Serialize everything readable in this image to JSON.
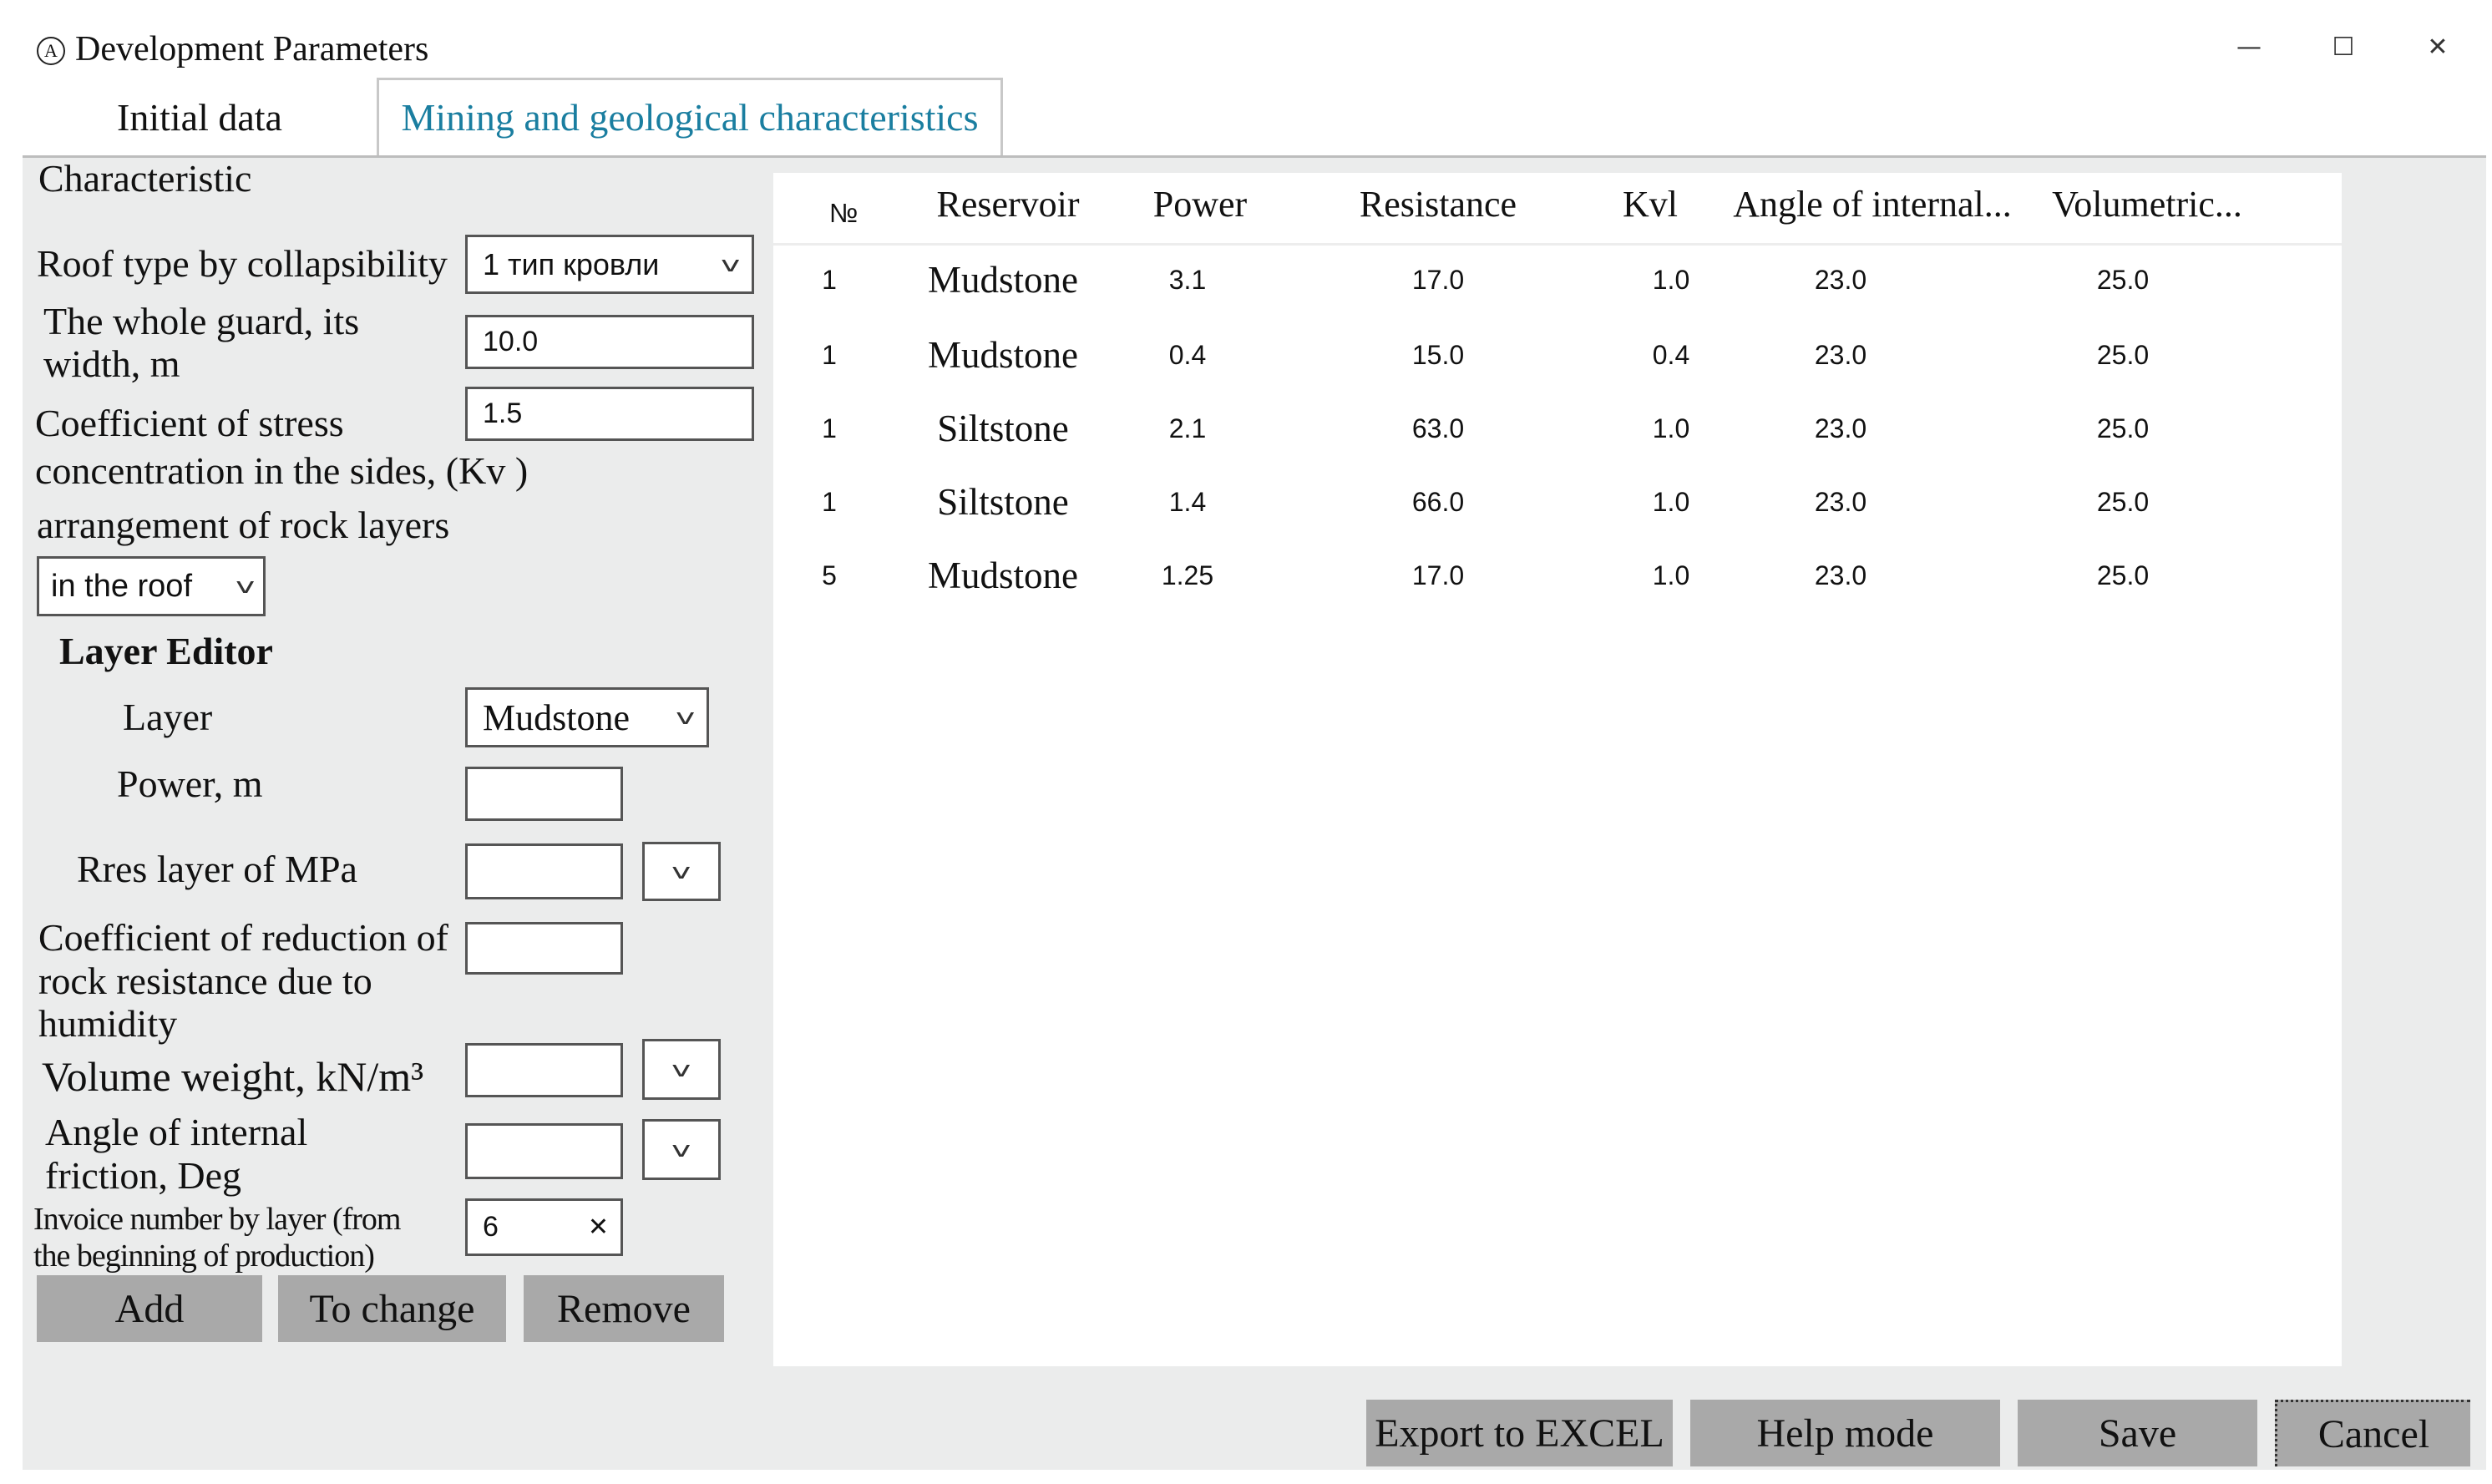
{
  "window": {
    "title": "Development Parameters",
    "logo_letter": "A",
    "minimize": "—",
    "maximize": "☐",
    "close": "✕"
  },
  "tabs": [
    {
      "label": "Initial data",
      "active": false
    },
    {
      "label": "Mining and geological characteristics",
      "active": true
    }
  ],
  "form": {
    "section_title": "Characteristic",
    "roof_type": {
      "label": "Roof type by collapsibility",
      "value": "1 тип кровли"
    },
    "guard_width": {
      "label_line1": "The whole guard, its",
      "label_line2": "width, m",
      "value": "10.0"
    },
    "stress_coef": {
      "label_line1": "Coefficient of stress",
      "label_line2": "concentration in the sides, (Kv )",
      "value": "1.5"
    },
    "arrangement": {
      "label": "arrangement of rock layers",
      "value": "in the roof"
    },
    "layer_editor": {
      "title": "Layer Editor",
      "layer": {
        "label": "Layer",
        "value": "Mudstone"
      },
      "power": {
        "label": "Power, m",
        "value": ""
      },
      "rres": {
        "label": "Rres layer of MPa",
        "value": ""
      },
      "reduction_coef": {
        "label_line1": "Coefficient of reduction of",
        "label_line2": "rock resistance due to",
        "label_line3": "humidity",
        "value": ""
      },
      "volume_weight": {
        "label": "Volume weight, kN/m³",
        "value": ""
      },
      "friction_angle": {
        "label_line1": "Angle of internal",
        "label_line2": "friction, Deg",
        "value": ""
      },
      "invoice_number": {
        "label_line1": "Invoice number by layer (from",
        "label_line2": "the beginning of production)",
        "value": "6",
        "clear": "✕"
      }
    },
    "buttons": {
      "add": "Add",
      "change": "To change",
      "remove": "Remove"
    }
  },
  "table": {
    "columns": [
      "№",
      "Reservoir",
      "Power",
      "Resistance",
      "Kvl",
      "Angle of internal...",
      "Volumetric..."
    ],
    "rows": [
      [
        "1",
        "Mudstone",
        "3.1",
        "17.0",
        "1.0",
        "23.0",
        "25.0"
      ],
      [
        "1",
        "Mudstone",
        "0.4",
        "15.0",
        "0.4",
        "23.0",
        "25.0"
      ],
      [
        "1",
        "Siltstone",
        "2.1",
        "63.0",
        "1.0",
        "23.0",
        "25.0"
      ],
      [
        "1",
        "Siltstone",
        "1.4",
        "66.0",
        "1.0",
        "23.0",
        "25.0"
      ],
      [
        "5",
        "Mudstone",
        "1.25",
        "17.0",
        "1.0",
        "23.0",
        "25.0"
      ]
    ]
  },
  "footer": {
    "export": "Export to EXCEL",
    "help": "Help mode",
    "save": "Save",
    "cancel": "Cancel"
  },
  "colors": {
    "accent_tab": "#1a7ea0",
    "button_gray": "#a9a9a9",
    "panel_bg": "#ebecec"
  }
}
